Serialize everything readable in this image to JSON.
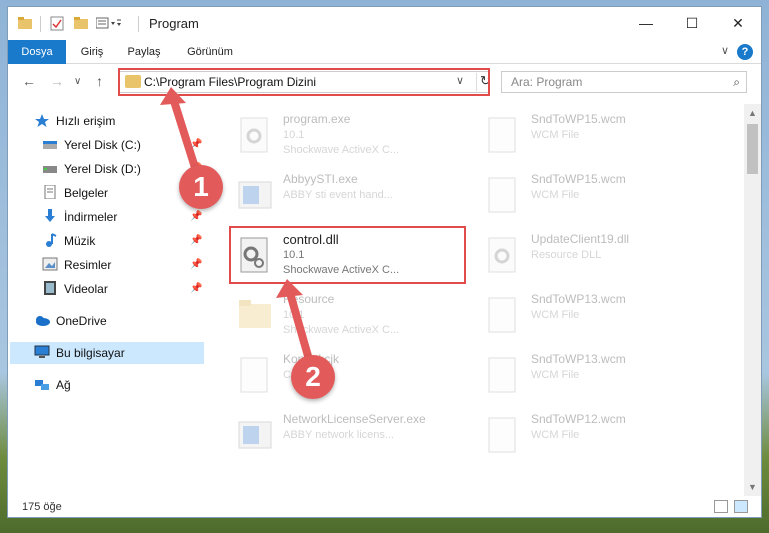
{
  "window": {
    "title": "Program",
    "minimize": "—",
    "maximize": "☐",
    "close": "✕"
  },
  "ribbon": {
    "tabs": [
      "Dosya",
      "Giriş",
      "Paylaş",
      "Görünüm"
    ],
    "help": "?",
    "expand": "∨"
  },
  "nav": {
    "back": "←",
    "forward": "→",
    "recent": "∨",
    "up": "↑",
    "address": "C:\\Program Files\\Program Dizini",
    "address_dropdown": "∨",
    "refresh": "↻",
    "search_placeholder": "Ara: Program",
    "search_icon": "⌕"
  },
  "sidebar": {
    "quick_access": "Hızlı erişim",
    "items": [
      {
        "label": "Yerel Disk (C:)",
        "icon": "drive-icon"
      },
      {
        "label": "Yerel Disk (D:)",
        "icon": "drive-icon"
      },
      {
        "label": "Belgeler",
        "icon": "documents-icon"
      },
      {
        "label": "İndirmeler",
        "icon": "download-icon"
      },
      {
        "label": "Müzik",
        "icon": "music-icon"
      },
      {
        "label": "Resimler",
        "icon": "pictures-icon"
      },
      {
        "label": "Videolar",
        "icon": "video-icon"
      }
    ],
    "onedrive": "OneDrive",
    "this_pc": "Bu bilgisayar",
    "network": "Ağ",
    "pin_glyph": "📌"
  },
  "files": {
    "col1": [
      {
        "name": "program.exe",
        "line1": "10.1",
        "line2": "Shockwave ActiveX C..."
      },
      {
        "name": "AbbyySTI.exe",
        "line1": "ABBY sti event hand...",
        "line2": ""
      },
      {
        "name": "control.dll",
        "line1": "10.1",
        "line2": "Shockwave ActiveX C..."
      },
      {
        "name": "Resource",
        "line1": "10.1",
        "line2": "Shockwave ActiveX C..."
      },
      {
        "name": "Kontrol.cjk",
        "line1": "CJK File",
        "line2": ""
      },
      {
        "name": "NetworkLicenseServer.exe",
        "line1": "ABBY network licens...",
        "line2": ""
      }
    ],
    "col2": [
      {
        "name": "SndToWP15.wcm",
        "line1": "WCM File"
      },
      {
        "name": "SndToWP15.wcm",
        "line1": "WCM File"
      },
      {
        "name": "UpdateClient19.dll",
        "line1": "Resource DLL"
      },
      {
        "name": "SndToWP13.wcm",
        "line1": "WCM File"
      },
      {
        "name": "SndToWP13.wcm",
        "line1": "WCM File"
      },
      {
        "name": "SndToWP12.wcm",
        "line1": "WCM File"
      }
    ]
  },
  "status": {
    "count": "175 öğe"
  },
  "annotations": {
    "callout1": "1",
    "callout2": "2",
    "color": "#e04b4b"
  }
}
